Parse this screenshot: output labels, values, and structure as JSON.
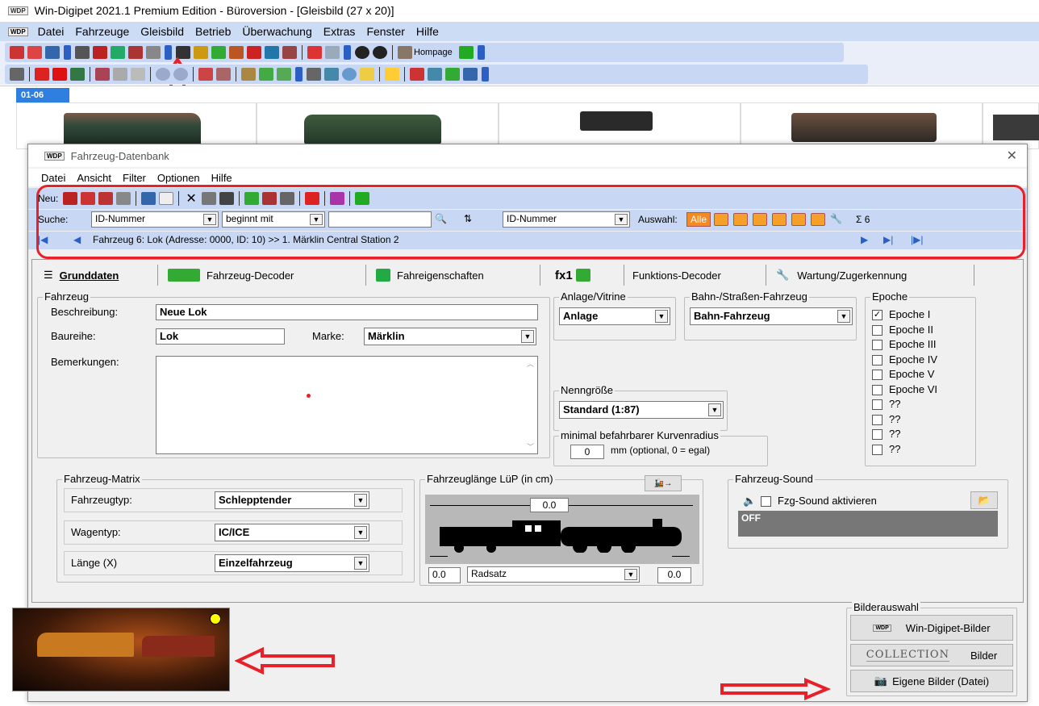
{
  "app": {
    "logo": "WDP",
    "title": "Win-Digipet 2021.1 Premium Edition - Büroversion - [Gleisbild (27 x 20)]"
  },
  "menu": [
    "Datei",
    "Fahrzeuge",
    "Gleisbild",
    "Betrieb",
    "Überwachung",
    "Extras",
    "Fenster",
    "Hilfe"
  ],
  "toolbar1": {
    "homepage": "Hompage"
  },
  "strip": {
    "tab": "01-06"
  },
  "dialog": {
    "title": "Fahrzeug-Datenbank",
    "menu": [
      "Datei",
      "Ansicht",
      "Filter",
      "Optionen",
      "Hilfe"
    ],
    "new_label": "Neu:",
    "search_label": "Suche:",
    "search_field": "ID-Nummer",
    "search_mode": "beginnt mit",
    "sort_field": "ID-Nummer",
    "auswahl_label": "Auswahl:",
    "alle": "Alle",
    "sum": "Σ 6",
    "nav_text": "Fahrzeug 6: Lok (Adresse: 0000, ID: 10) >> 1. Märklin Central Station 2",
    "tabs": [
      "Grunddaten",
      "Fahrzeug-Decoder",
      "Fahreigenschaften",
      "fx1",
      "Funktions-Decoder",
      "Wartung/Zugerkennung"
    ],
    "fahrzeug": {
      "legend": "Fahrzeug",
      "beschreibung_label": "Beschreibung:",
      "beschreibung": "Neue Lok",
      "baureihe_label": "Baureihe:",
      "baureihe": "Lok",
      "marke_label": "Marke:",
      "marke": "Märklin",
      "bemerkungen_label": "Bemerkungen:"
    },
    "anlage": {
      "legend": "Anlage/Vitrine",
      "value": "Anlage"
    },
    "bahn": {
      "legend": "Bahn-/Straßen-Fahrzeug",
      "value": "Bahn-Fahrzeug"
    },
    "epoche": {
      "legend": "Epoche",
      "items": [
        {
          "label": "Epoche I",
          "checked": "✓"
        },
        {
          "label": "Epoche II",
          "checked": ""
        },
        {
          "label": "Epoche III",
          "checked": ""
        },
        {
          "label": "Epoche IV",
          "checked": ""
        },
        {
          "label": "Epoche V",
          "checked": ""
        },
        {
          "label": "Epoche VI",
          "checked": ""
        },
        {
          "label": "??",
          "checked": ""
        },
        {
          "label": "??",
          "checked": ""
        },
        {
          "label": "??",
          "checked": ""
        },
        {
          "label": "??",
          "checked": ""
        }
      ]
    },
    "nenn": {
      "legend": "Nenngröße",
      "value": "Standard (1:87)"
    },
    "kurve": {
      "legend": "minimal befahrbarer Kurvenradius",
      "value": "0",
      "unit": "mm (optional, 0 = egal)"
    },
    "matrix": {
      "legend": "Fahrzeug-Matrix",
      "typ_label": "Fahrzeugtyp:",
      "typ": "Schlepptender",
      "wagen_label": "Wagentyp:",
      "wagen": "IC/ICE",
      "laenge_label": "Länge (X)",
      "laenge": "Einzelfahrzeug"
    },
    "lengthbox": {
      "legend": "Fahrzeuglänge LüP (in cm)",
      "total": "0.0",
      "left": "0.0",
      "mode": "Radsatz",
      "right": "0.0"
    },
    "sound": {
      "legend": "Fahrzeug-Sound",
      "check": "Fzg-Sound aktivieren",
      "value": "OFF"
    },
    "bilder": {
      "legend": "Bilderauswahl",
      "wdp": "Win-Digipet-Bilder",
      "collection": "COLLECTION",
      "collection_bilder": "Bilder",
      "eigene": "Eigene Bilder (Datei)"
    }
  },
  "colors": {
    "highlight": "#e8202a",
    "toolbar_blue": "#c8d8f4",
    "dialog_bg": "#f0f0f0"
  }
}
